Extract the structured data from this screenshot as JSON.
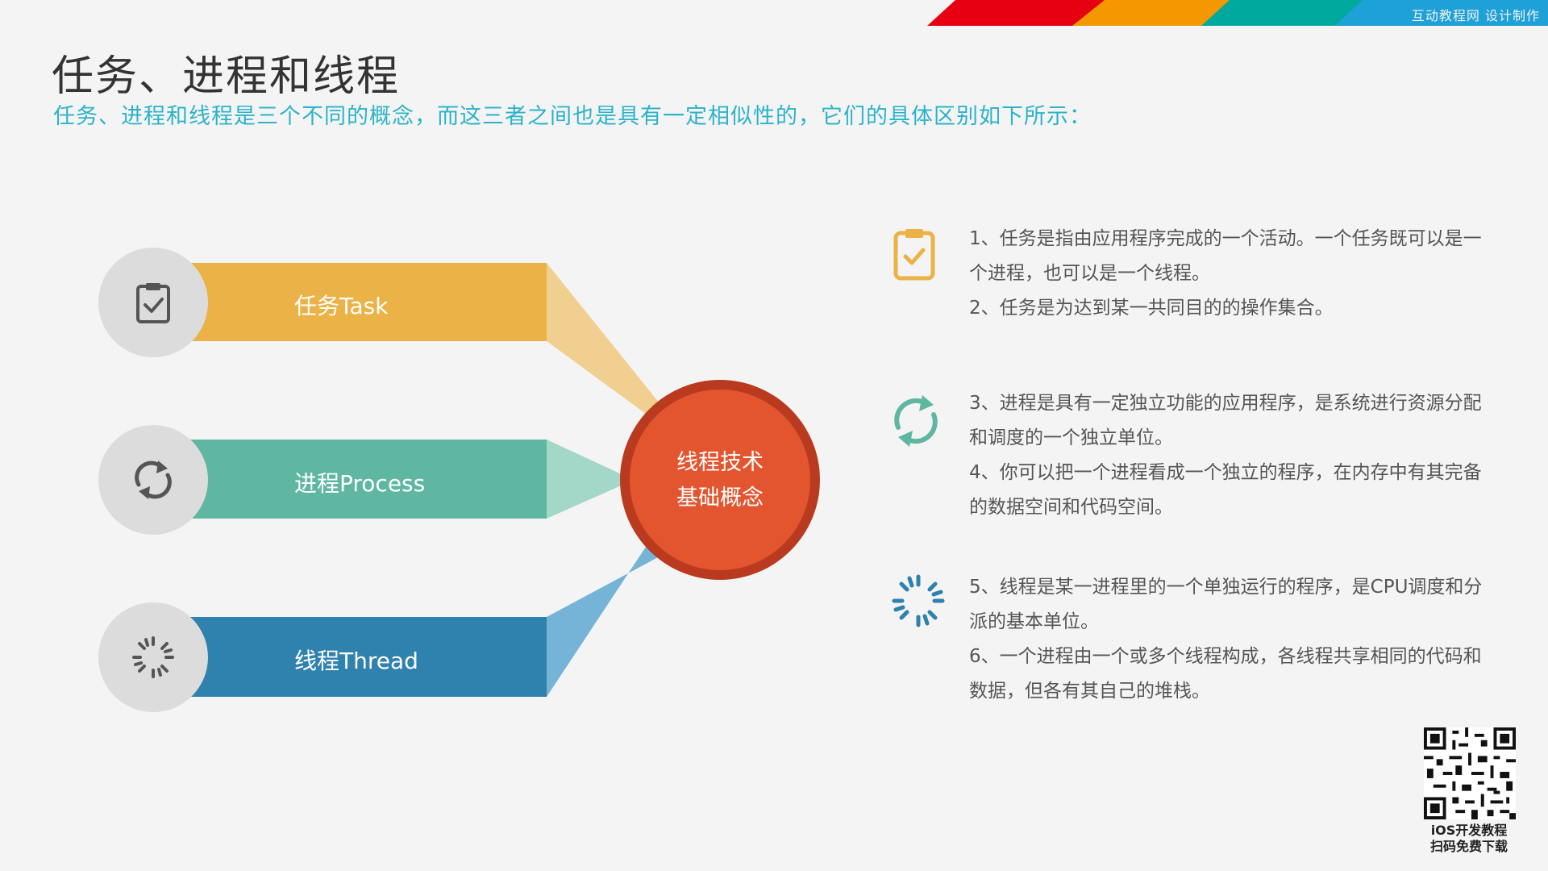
{
  "header": {
    "brand": "互动教程网 设计制作",
    "colors": [
      "#e60012",
      "#f39800",
      "#00a99d",
      "#1da1d6"
    ]
  },
  "title": "任务、进程和线程",
  "subtitle": "任务、进程和线程是三个不同的概念，而这三者之间也是具有一定相似性的，它们的具体区别如下所示：",
  "center": {
    "line1": "线程技术",
    "line2": "基础概念",
    "color": "#e3552f"
  },
  "bands": [
    {
      "label": "任务Task",
      "icon": "clipboard-check-icon",
      "color": "#ebb247",
      "fan_color": "#f1cf91"
    },
    {
      "label": "进程Process",
      "icon": "refresh-cycle-icon",
      "color": "#5fb7a2",
      "fan_color": "#a3d8c8"
    },
    {
      "label": "线程Thread",
      "icon": "loading-spinner-icon",
      "color": "#2f81ae",
      "fan_color": "#76b4d7"
    }
  ],
  "notes": [
    {
      "icon": "clipboard-check-icon",
      "color": "#ebb247",
      "lines": [
        "1、任务是指由应用程序完成的一个活动。一个任务既可以是一个进程，也可以是一个线程。",
        "2、任务是为达到某一共同目的的操作集合。"
      ]
    },
    {
      "icon": "refresh-cycle-icon",
      "color": "#5fb7a2",
      "lines": [
        "3、进程是具有一定独立功能的应用程序，是系统进行资源分配和调度的一个独立单位。",
        "4、你可以把一个进程看成一个独立的程序，在内存中有其完备的数据空间和代码空间。"
      ]
    },
    {
      "icon": "loading-spinner-icon",
      "color": "#2f81ae",
      "lines": [
        "5、线程是某一进程里的一个单独运行的程序，是CPU调度和分派的基本单位。",
        "6、一个进程由一个或多个线程构成，各线程共享相同的代码和数据，但各有其自己的堆栈。"
      ]
    }
  ],
  "qr": {
    "line1": "iOS开发教程",
    "line2": "扫码免费下载"
  }
}
